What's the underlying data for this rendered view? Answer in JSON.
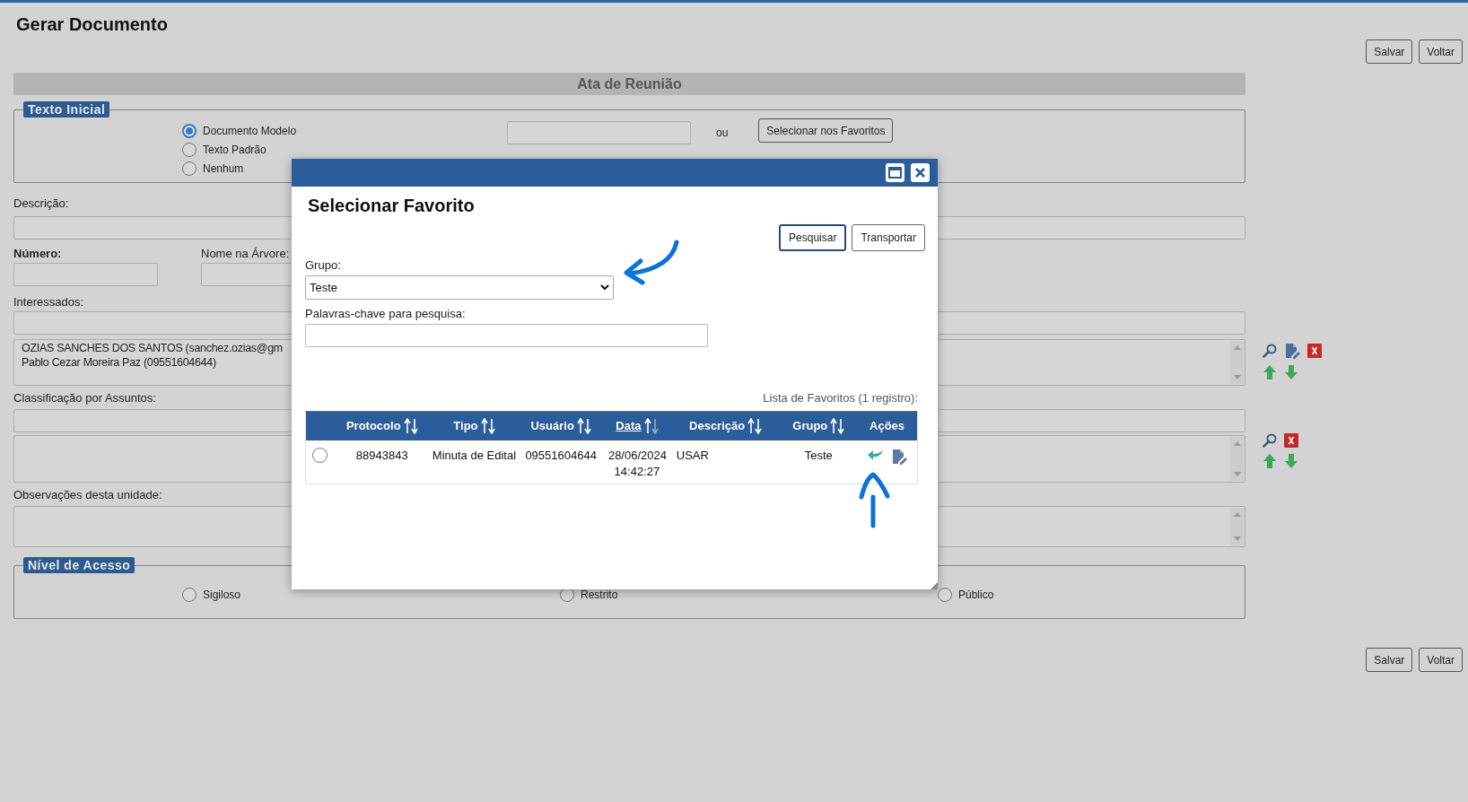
{
  "page_title": "Gerar Documento",
  "top_buttons": [
    "Salvar",
    "Voltar"
  ],
  "section_title": "Ata de Reunião",
  "texto_inicial": {
    "legend": "Texto Inicial",
    "options": [
      {
        "label": "Documento Modelo",
        "selected": true
      },
      {
        "label": "Texto Padrão",
        "selected": false
      },
      {
        "label": "Nenhum",
        "selected": false
      }
    ],
    "separator": "ou",
    "button": "Selecionar nos Favoritos"
  },
  "descricao": {
    "label": "Descrição:"
  },
  "numero": {
    "label": "Número:"
  },
  "nome_arvore": {
    "label": "Nome na Árvore:"
  },
  "interessados": {
    "label": "Interessados:",
    "items": [
      "OZIAS SANCHES DOS SANTOS (sanchez.ozias@gm",
      "Pablo Cezar Moreira Paz (09551604644)"
    ]
  },
  "classificacao": {
    "label": "Classificação por Assuntos:"
  },
  "observacoes": {
    "label": "Observações desta unidade:"
  },
  "nivel_acesso": {
    "legend": "Nível de Acesso",
    "options": [
      {
        "label": "Sigiloso",
        "selected": false
      },
      {
        "label": "Restrito",
        "selected": false
      },
      {
        "label": "Público",
        "selected": false
      }
    ]
  },
  "bottom_buttons": [
    "Salvar",
    "Voltar"
  ],
  "modal": {
    "title": "Selecionar Favorito",
    "buttons": [
      "Pesquisar",
      "Transportar"
    ],
    "grupo": {
      "label": "Grupo:",
      "value": "Teste"
    },
    "palavras": {
      "label": "Palavras-chave para pesquisa:"
    },
    "list_caption": "Lista de Favoritos (1 registro):",
    "table": {
      "columns": [
        {
          "label": "Protocolo",
          "sortable": true,
          "sorted": false
        },
        {
          "label": "Tipo",
          "sortable": true,
          "sorted": false
        },
        {
          "label": "Usuário",
          "sortable": true,
          "sorted": false
        },
        {
          "label": "Data",
          "sortable": true,
          "sorted": true
        },
        {
          "label": "Descrição",
          "sortable": true,
          "sorted": false
        },
        {
          "label": "Grupo",
          "sortable": true,
          "sorted": false
        },
        {
          "label": "Ações",
          "sortable": false,
          "sorted": false
        }
      ],
      "rows": [
        {
          "selected": false,
          "cells": [
            "88943843",
            "Minuta de Edital",
            "09551604644",
            "28/06/2024 14:42:27",
            "USAR",
            "Teste"
          ]
        }
      ]
    }
  }
}
